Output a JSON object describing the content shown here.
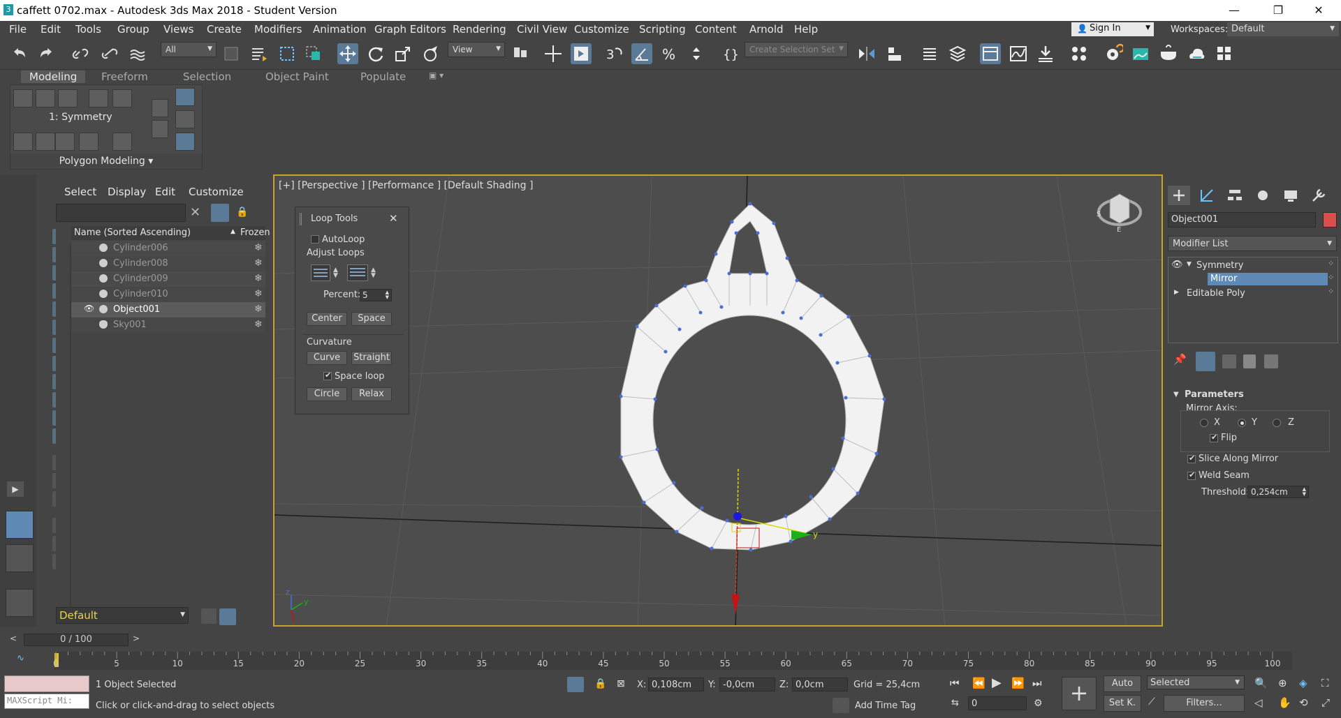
{
  "window": {
    "title": "caffett 0702.max - Autodesk 3ds Max 2018 - Student Version",
    "min": "—",
    "max": "❐",
    "close": "✕"
  },
  "menu": [
    "File",
    "Edit",
    "Tools",
    "Group",
    "Views",
    "Create",
    "Modifiers",
    "Animation",
    "Graph Editors",
    "Rendering",
    "Civil View",
    "Customize",
    "Scripting",
    "Content",
    "Arnold",
    "Help"
  ],
  "account": {
    "sign_in": "Sign In",
    "workspaces_label": "Workspaces:",
    "workspace_value": "Default"
  },
  "toolbar": {
    "filter_value": "All",
    "view_value": "View",
    "selection_set_placeholder": "Create Selection Set"
  },
  "ribbon": {
    "tabs": [
      "Modeling",
      "Freeform",
      "Selection",
      "Object Paint",
      "Populate"
    ],
    "mode_label": "1: Symmetry",
    "group_label": "Polygon Modeling"
  },
  "scene_explorer": {
    "menus": [
      "Select",
      "Display",
      "Edit",
      "Customize"
    ],
    "col_name": "Name (Sorted Ascending)",
    "col_sort": "▲",
    "col_frozen": "Frozen",
    "rows": [
      {
        "name": "Cylinder006"
      },
      {
        "name": "Cylinder008"
      },
      {
        "name": "Cylinder009"
      },
      {
        "name": "Cylinder010"
      },
      {
        "name": "Object001"
      },
      {
        "name": "Sky001"
      }
    ],
    "layer_value": "Default"
  },
  "viewport": {
    "label": "[+] [Perspective ] [Performance ] [Default Shading ]"
  },
  "loop_tools": {
    "title": "Loop Tools",
    "autoloop": "AutoLoop",
    "adjust_loops": "Adjust Loops",
    "percent_label": "Percent:",
    "percent_value": "5",
    "center": "Center",
    "space": "Space",
    "curvature": "Curvature",
    "curve": "Curve",
    "straight": "Straight",
    "space_loop": "Space loop",
    "circle": "Circle",
    "relax": "Relax"
  },
  "command_panel": {
    "object_name": "Object001",
    "modifier_list": "Modifier List",
    "stack": [
      {
        "label": "Symmetry"
      },
      {
        "label": "Mirror"
      },
      {
        "label": "Editable Poly"
      }
    ],
    "params_title": "Parameters",
    "mirror_axis": "Mirror Axis:",
    "axis_x": "X",
    "axis_y": "Y",
    "axis_z": "Z",
    "flip": "Flip",
    "slice": "Slice Along Mirror",
    "weld": "Weld Seam",
    "threshold_label": "Threshold:",
    "threshold_value": "0,254cm"
  },
  "timeline": {
    "slider_text": "0 / 100",
    "ticks": [
      "0",
      "5",
      "10",
      "15",
      "20",
      "25",
      "30",
      "35",
      "40",
      "45",
      "50",
      "55",
      "60",
      "65",
      "70",
      "75",
      "80",
      "85",
      "90",
      "95",
      "100"
    ]
  },
  "status": {
    "maxscript": "MAXScript Mi:",
    "selected_count": "1 Object Selected",
    "prompt": "Click or click-and-drag to select objects",
    "x_label": "X:",
    "x_value": "0,108cm",
    "y_label": "Y:",
    "y_value": "-0,0cm",
    "z_label": "Z:",
    "z_value": "0,0cm",
    "grid": "Grid = 25,4cm",
    "add_time_tag": "Add Time Tag",
    "auto": "Auto",
    "set_key": "Set K.",
    "selected": "Selected",
    "filters": "Filters...",
    "frame": "0"
  }
}
